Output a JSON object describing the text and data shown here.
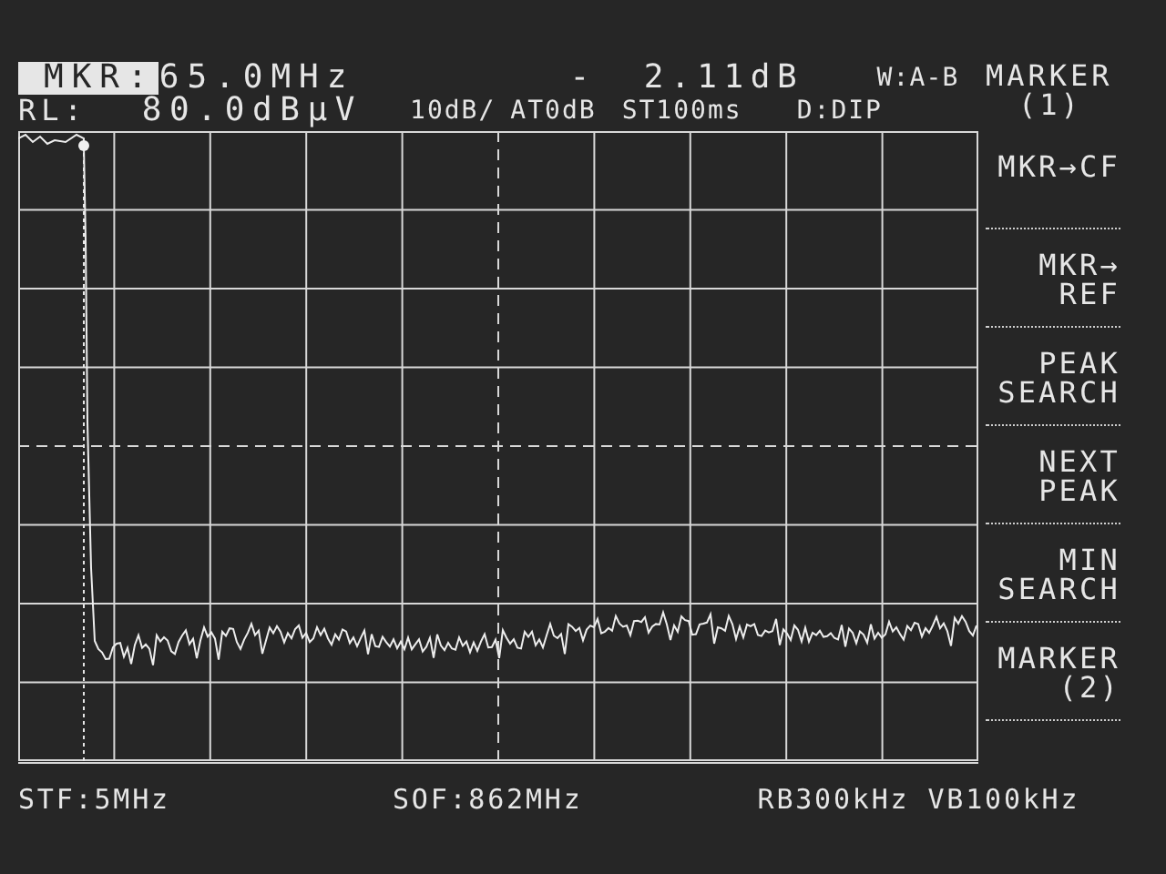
{
  "marker_readout": {
    "label": "MKR:",
    "frequency": "65.0MHz",
    "delta_sign": "-",
    "delta_value": "2.11dB",
    "window_mode": "W:A-B"
  },
  "settings_line": {
    "ref_label": "RL:",
    "ref_level": "80.0dBμV",
    "scale": "10dB/",
    "attenuation": "AT0dB",
    "sweep_time": "ST100ms",
    "detector": "D:DIP"
  },
  "menu_title": [
    "MARKER",
    "(1)"
  ],
  "softkeys": [
    {
      "lines": [
        "MKR→CF"
      ]
    },
    {
      "lines": [
        "MKR→",
        "REF"
      ]
    },
    {
      "lines": [
        "PEAK",
        "SEARCH"
      ]
    },
    {
      "lines": [
        "NEXT",
        "PEAK"
      ]
    },
    {
      "lines": [
        "MIN",
        "SEARCH"
      ]
    },
    {
      "lines": [
        "MARKER",
        "(2)"
      ]
    }
  ],
  "status_bar": {
    "start_frequency": "STF:5MHz",
    "offset_frequency": "SOF:862MHz",
    "resolution_bandwidth": "RB300kHz",
    "video_bandwidth": "VB100kHz"
  }
}
